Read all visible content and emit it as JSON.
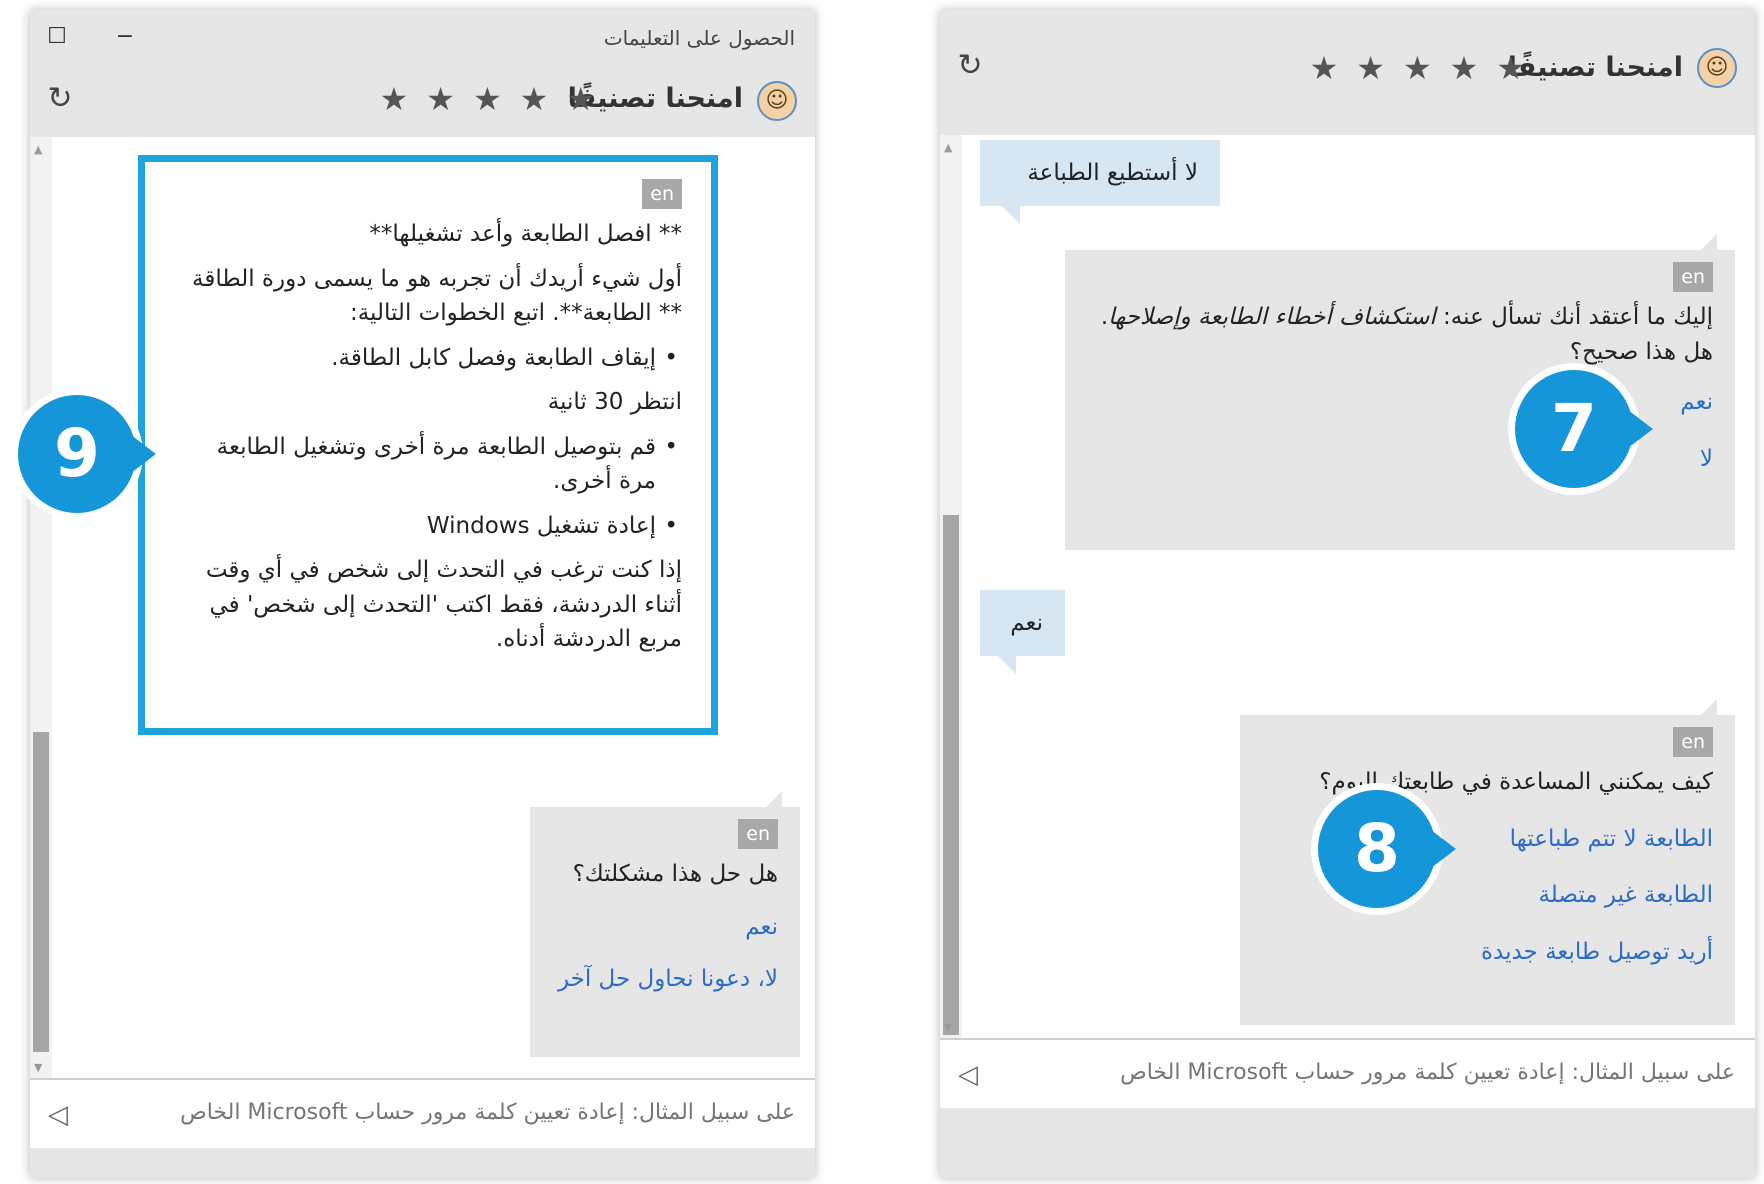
{
  "colors": {
    "accent": "#1ea3dd",
    "callout": "#1496d8",
    "link": "#2b6cc4",
    "user_bubble": "#d6e6f3",
    "bot_bubble": "#e6e6e6"
  },
  "icons": {
    "refresh": "refresh-icon",
    "minimize": "minimize-icon",
    "maximize": "maximize-icon",
    "star": "star-icon",
    "send": "send-icon",
    "avatar": "agent-avatar-icon"
  },
  "left_window": {
    "title": "الحصول على التعليمات",
    "rate_label": "امنحنا تصنيفًا",
    "highlight_message": {
      "lang": "en",
      "heading": "** افصل الطابعة وأعد تشغيلها**",
      "intro": "أول شيء أريدك أن تجربه هو ما يسمى دورة الطاقة ** الطابعة**. اتبع الخطوات التالية:",
      "step1": "إيقاف الطابعة وفصل كابل الطاقة.",
      "wait": "انتظر 30 ثانية",
      "step2": "قم بتوصيل الطابعة مرة أخرى وتشغيل الطابعة مرة أخرى.",
      "step3": "إعادة تشغيل Windows",
      "outro": "إذا كنت ترغب في التحدث إلى شخص في أي وقت أثناء الدردشة، فقط اكتب 'التحدث إلى شخص' في مربع الدردشة أدناه."
    },
    "question_message": {
      "lang": "en",
      "question": "هل حل هذا مشكلتك؟",
      "option_yes": "نعم",
      "option_no": "لا، دعونا نحاول حل آخر"
    },
    "callout": "9",
    "input_placeholder": "على سبيل المثال: إعادة تعيين كلمة مرور حساب Microsoft الخاص"
  },
  "right_window": {
    "rate_label": "امنحنا تصنيفًا",
    "user_message_1": "لا أستطيع الطباعة",
    "bot_message_1": {
      "lang": "en",
      "text_plain": "إليك ما أعتقد أنك تسأل عنه: ",
      "text_italic": "استكشاف أخطاء الطابعة وإصلاحها",
      "text_tail": ". هل هذا صحيح؟",
      "option_yes": "نعم",
      "option_no": "لا"
    },
    "user_message_2": "نعم",
    "bot_message_2": {
      "lang": "en",
      "question": "كيف يمكنني المساعدة في طابعتك اليوم؟",
      "option_1": "الطابعة لا تتم طباعتها",
      "option_2": "الطابعة غير متصلة",
      "option_3": "أريد توصيل طابعة جديدة"
    },
    "callout_a": "7",
    "callout_b": "8",
    "input_placeholder": "على سبيل المثال: إعادة تعيين كلمة مرور حساب Microsoft الخاص"
  }
}
